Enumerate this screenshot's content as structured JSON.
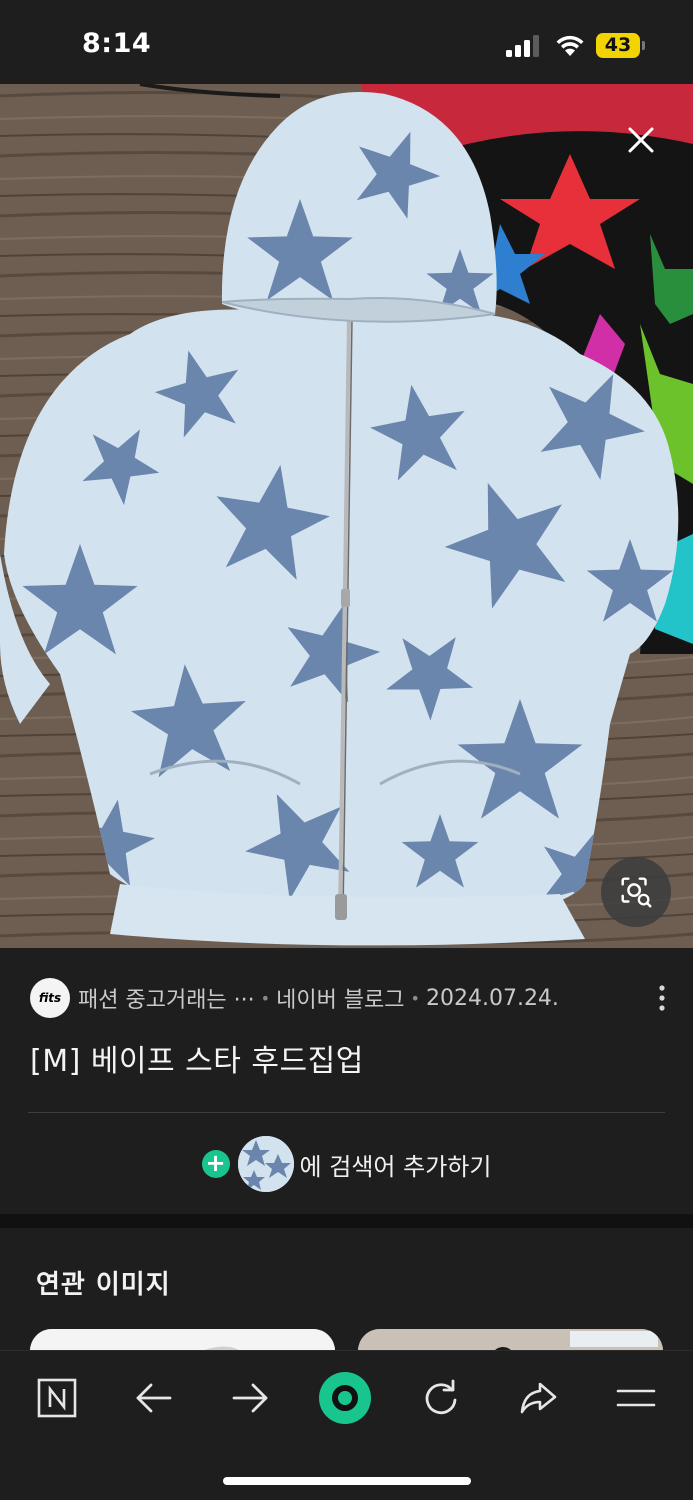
{
  "status_bar": {
    "time": "8:14",
    "battery_level": "43",
    "battery_color": "#f2d400"
  },
  "image_viewer": {
    "close_icon": "close-icon",
    "lens_icon": "image-search-icon"
  },
  "result": {
    "source_logo": "fits",
    "source_name": "패션 중고거래는 ···",
    "platform": "네이버 블로그",
    "date": "2024.07.24.",
    "title": "[M] 베이프 스타 후드집업"
  },
  "search_add": {
    "label": "에 검색어 추가하기",
    "accent_color": "#19c58f"
  },
  "related": {
    "title": "연관 이미지"
  },
  "toolbar": {
    "items": [
      "naver-home-icon",
      "back-arrow-icon",
      "forward-arrow-icon",
      "green-dot-icon",
      "refresh-icon",
      "share-icon",
      "menu-icon"
    ],
    "accent_color": "#19c58f"
  }
}
